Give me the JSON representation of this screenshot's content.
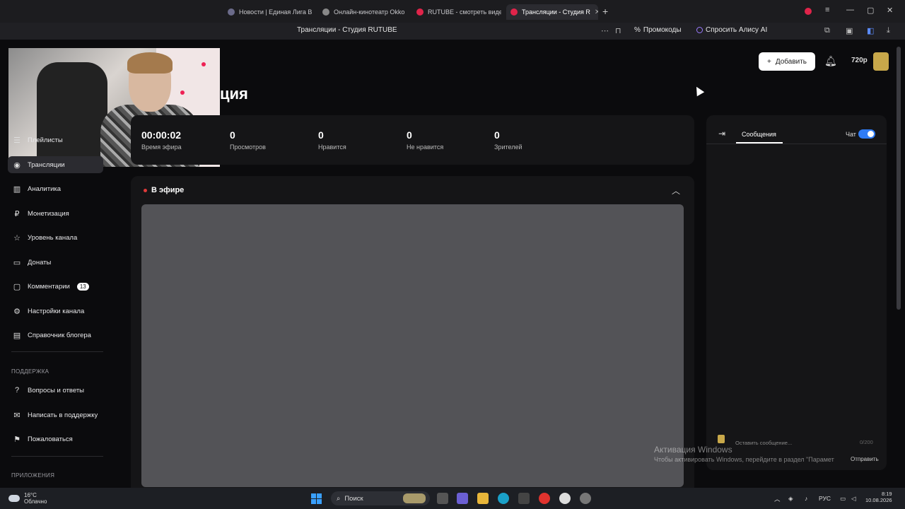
{
  "browser": {
    "tabs": [
      {
        "label": "Новости | Единая Лига В",
        "color": "#6b6b8a"
      },
      {
        "label": "Онлайн-кинотеатр Okko",
        "color": "#888"
      },
      {
        "label": "RUTUBE - смотреть видео",
        "color": "#e0244a"
      },
      {
        "label": "Трансляции - Студия R",
        "color": "#e0244a",
        "active": true
      }
    ],
    "address_title": "Трансляции - Студия RUTUBE",
    "promo_label": "Промокоды",
    "alice_label": "Спросить Алису AI"
  },
  "header": {
    "page_heading": "ция",
    "add_button": "Добавить",
    "quality": "720p"
  },
  "sidebar": {
    "items": [
      {
        "label": "Плейлисты",
        "icon": "playlist-icon",
        "glyph": "☰"
      },
      {
        "label": "Трансляции",
        "icon": "broadcast-icon",
        "glyph": "◉",
        "active": true
      },
      {
        "label": "Аналитика",
        "icon": "analytics-icon",
        "glyph": "▥"
      },
      {
        "label": "Монетизация",
        "icon": "money-icon",
        "glyph": "₽"
      },
      {
        "label": "Уровень канала",
        "icon": "star-icon",
        "glyph": "☆"
      },
      {
        "label": "Донаты",
        "icon": "donate-icon",
        "glyph": "▭"
      },
      {
        "label": "Комментарии",
        "icon": "comment-icon",
        "glyph": "▢",
        "badge": "13"
      },
      {
        "label": "Настройки канала",
        "icon": "gear-icon",
        "glyph": "⚙"
      },
      {
        "label": "Справочник блогера",
        "icon": "book-icon",
        "glyph": "▤"
      }
    ],
    "support_label": "ПОДДЕРЖКА",
    "support_items": [
      {
        "label": "Вопросы и ответы",
        "icon": "help-icon",
        "glyph": "?"
      },
      {
        "label": "Написать в поддержку",
        "icon": "mail-icon",
        "glyph": "✉"
      },
      {
        "label": "Пожаловаться",
        "icon": "flag-icon",
        "glyph": "⚑"
      }
    ],
    "apps_label": "ПРИЛОЖЕНИЯ"
  },
  "stats": [
    {
      "value": "00:00:02",
      "label": "Время эфира"
    },
    {
      "value": "0",
      "label": "Просмотров"
    },
    {
      "value": "0",
      "label": "Нравится"
    },
    {
      "value": "0",
      "label": "Не нравится"
    },
    {
      "value": "0",
      "label": "Зрителей"
    }
  ],
  "live": {
    "title": "В эфире"
  },
  "chat": {
    "tab": "Сообщения",
    "toggle_label": "Чат",
    "toggle_on": true,
    "input_placeholder": "Оставить сообщение...",
    "counter": "0/200",
    "send_label": "Отправить"
  },
  "activation": {
    "title": "Активация Windows",
    "subtitle": "Чтобы активировать Windows, перейдите в раздел \"Парамет"
  },
  "taskbar": {
    "temperature": "16°C",
    "weather": "Облачно",
    "search_label": "Поиск",
    "lang": "РУС",
    "time": "8:19",
    "date": "10.08.2026"
  }
}
